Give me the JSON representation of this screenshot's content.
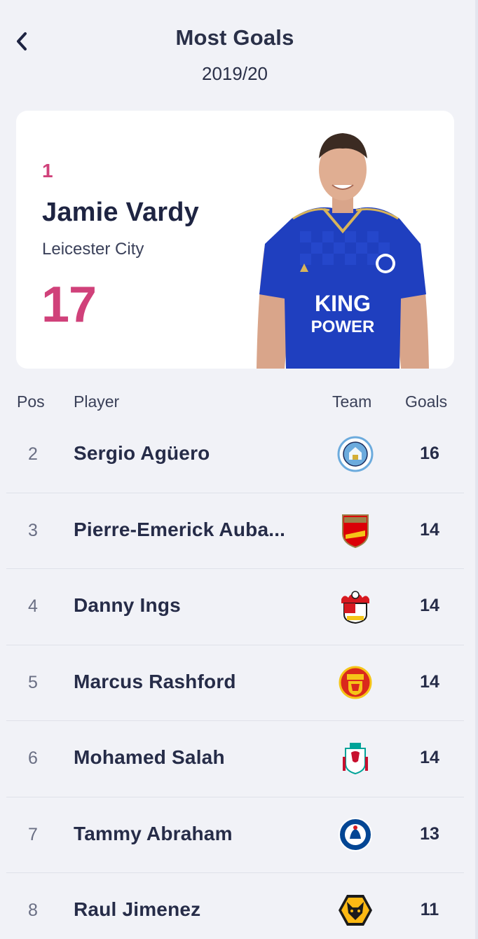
{
  "header": {
    "title": "Most Goals",
    "season": "2019/20"
  },
  "featured": {
    "rank": "1",
    "name": "Jamie Vardy",
    "team": "Leicester City",
    "goals": "17",
    "shirt_text_line1": "KING",
    "shirt_text_line2": "POWER"
  },
  "table": {
    "columns": [
      "Pos",
      "Player",
      "Team",
      "Goals"
    ],
    "rows": [
      {
        "pos": "2",
        "player": "Sergio Agüero",
        "team_crest": "man-city-crest-icon",
        "goals": "16"
      },
      {
        "pos": "3",
        "player": "Pierre-Emerick Auba...",
        "team_crest": "arsenal-crest-icon",
        "goals": "14"
      },
      {
        "pos": "4",
        "player": "Danny Ings",
        "team_crest": "southampton-crest-icon",
        "goals": "14"
      },
      {
        "pos": "5",
        "player": "Marcus Rashford",
        "team_crest": "man-united-crest-icon",
        "goals": "14"
      },
      {
        "pos": "6",
        "player": "Mohamed Salah",
        "team_crest": "liverpool-crest-icon",
        "goals": "14"
      },
      {
        "pos": "7",
        "player": "Tammy Abraham",
        "team_crest": "chelsea-crest-icon",
        "goals": "13"
      },
      {
        "pos": "8",
        "player": "Raul Jimenez",
        "team_crest": "wolves-crest-icon",
        "goals": "11"
      }
    ]
  },
  "colors": {
    "accent": "#d0417a",
    "text_dark": "#1e2442",
    "background": "#f1f2f7",
    "card": "#ffffff",
    "leicester_blue": "#1f3fbf"
  }
}
